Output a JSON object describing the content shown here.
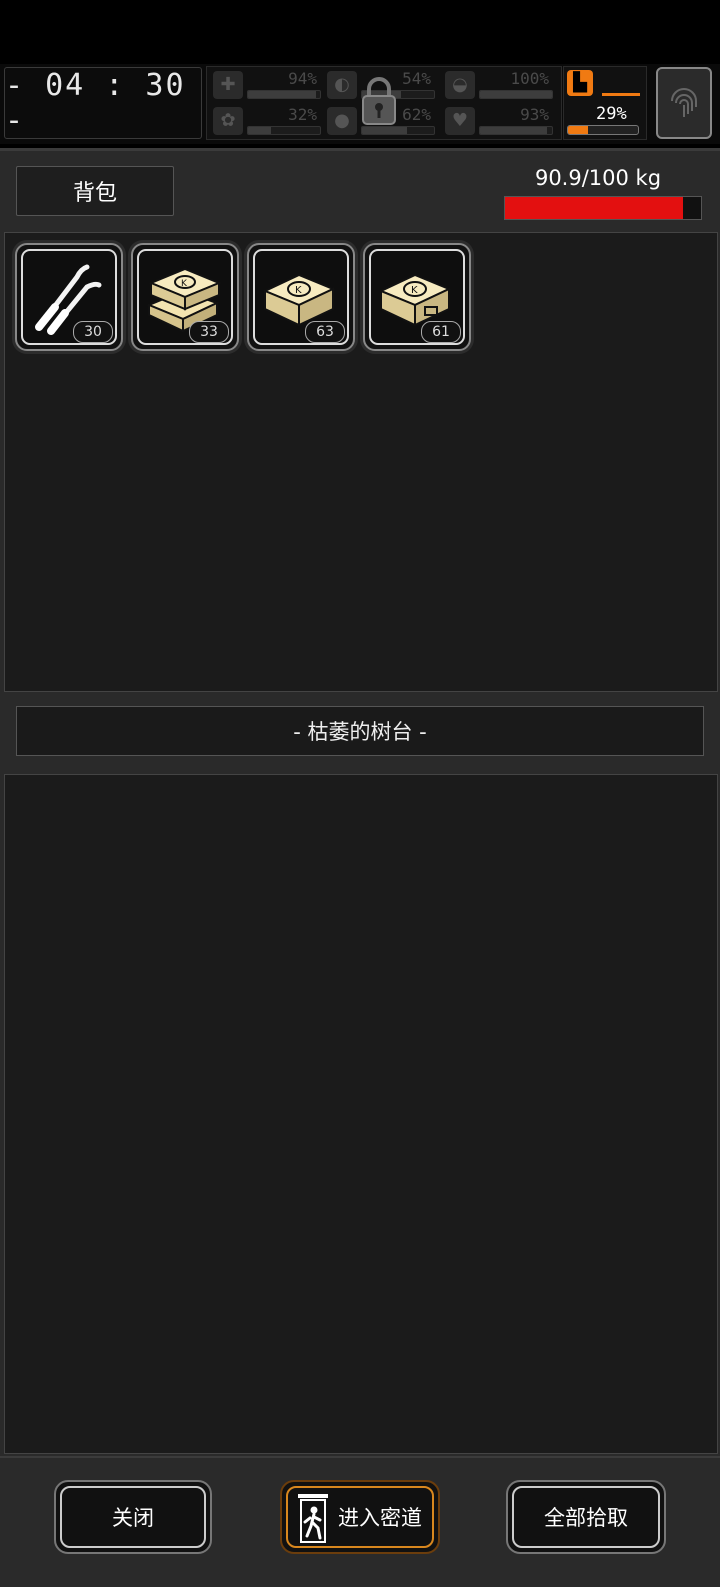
{
  "clock": "- 04 : 30 -",
  "stats": [
    {
      "name": "health",
      "icon": "medkit-icon",
      "value": "94%",
      "fill": 0.94
    },
    {
      "name": "hunger",
      "icon": "stomach-icon",
      "value": "54%",
      "fill": 0.54
    },
    {
      "name": "armor",
      "icon": "helmet-icon",
      "value": "100%",
      "fill": 1.0
    },
    {
      "name": "sanity",
      "icon": "brain-icon",
      "value": "32%",
      "fill": 0.32
    },
    {
      "name": "thirst",
      "icon": "water-drop-icon",
      "value": "62%",
      "fill": 0.62
    },
    {
      "name": "heart",
      "icon": "heart-icon",
      "value": "93%",
      "fill": 0.93
    }
  ],
  "stamina": {
    "value": "29%",
    "fill": 0.29,
    "icon": "boot-icon"
  },
  "backpack": {
    "title": "背包",
    "weight_label": "90.9/100 kg",
    "weight_fill": 0.909,
    "items": [
      {
        "icon": "lockpick-icon",
        "count": "30"
      },
      {
        "icon": "supply-box-stack-icon",
        "count": "33"
      },
      {
        "icon": "supply-box-icon",
        "count": "63"
      },
      {
        "icon": "supply-box-open-icon",
        "count": "61"
      }
    ]
  },
  "location": {
    "title": "- 枯萎的树台 -"
  },
  "buttons": {
    "close": "关闭",
    "secret_passage": "进入密道",
    "pick_all": "全部拾取"
  },
  "colors": {
    "weight_bar": "#e31010",
    "stamina": "#f07a12",
    "accent_button": "#d8871e"
  }
}
